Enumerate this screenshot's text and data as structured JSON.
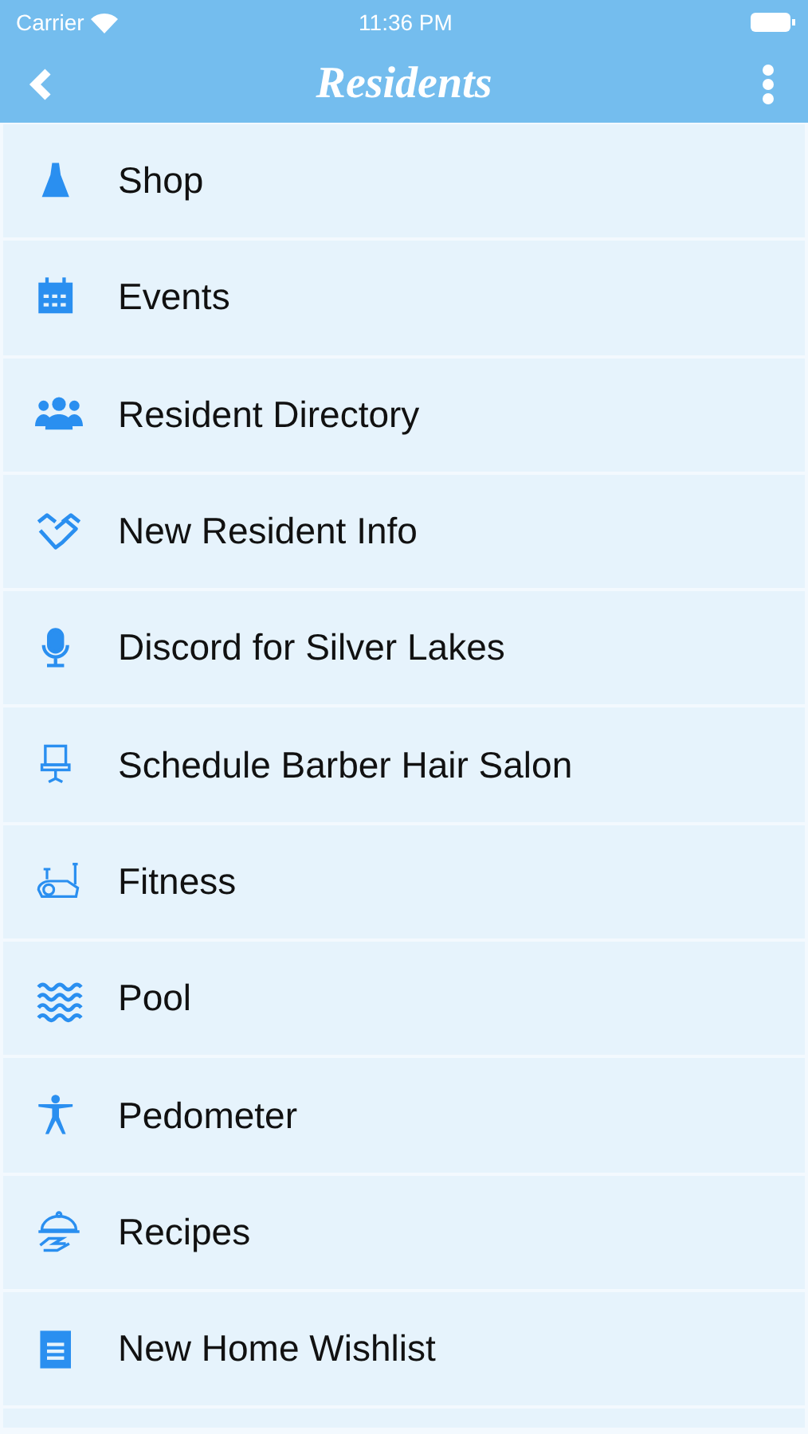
{
  "status_bar": {
    "carrier": "Carrier",
    "time": "11:36 PM"
  },
  "nav_bar": {
    "title": "Residents"
  },
  "menu_items": [
    {
      "label": "Shop"
    },
    {
      "label": "Events"
    },
    {
      "label": "Resident Directory"
    },
    {
      "label": "New Resident Info"
    },
    {
      "label": "Discord for Silver Lakes"
    },
    {
      "label": "Schedule Barber Hair Salon"
    },
    {
      "label": "Fitness"
    },
    {
      "label": "Pool"
    },
    {
      "label": "Pedometer"
    },
    {
      "label": "Recipes"
    },
    {
      "label": "New Home Wishlist"
    }
  ]
}
